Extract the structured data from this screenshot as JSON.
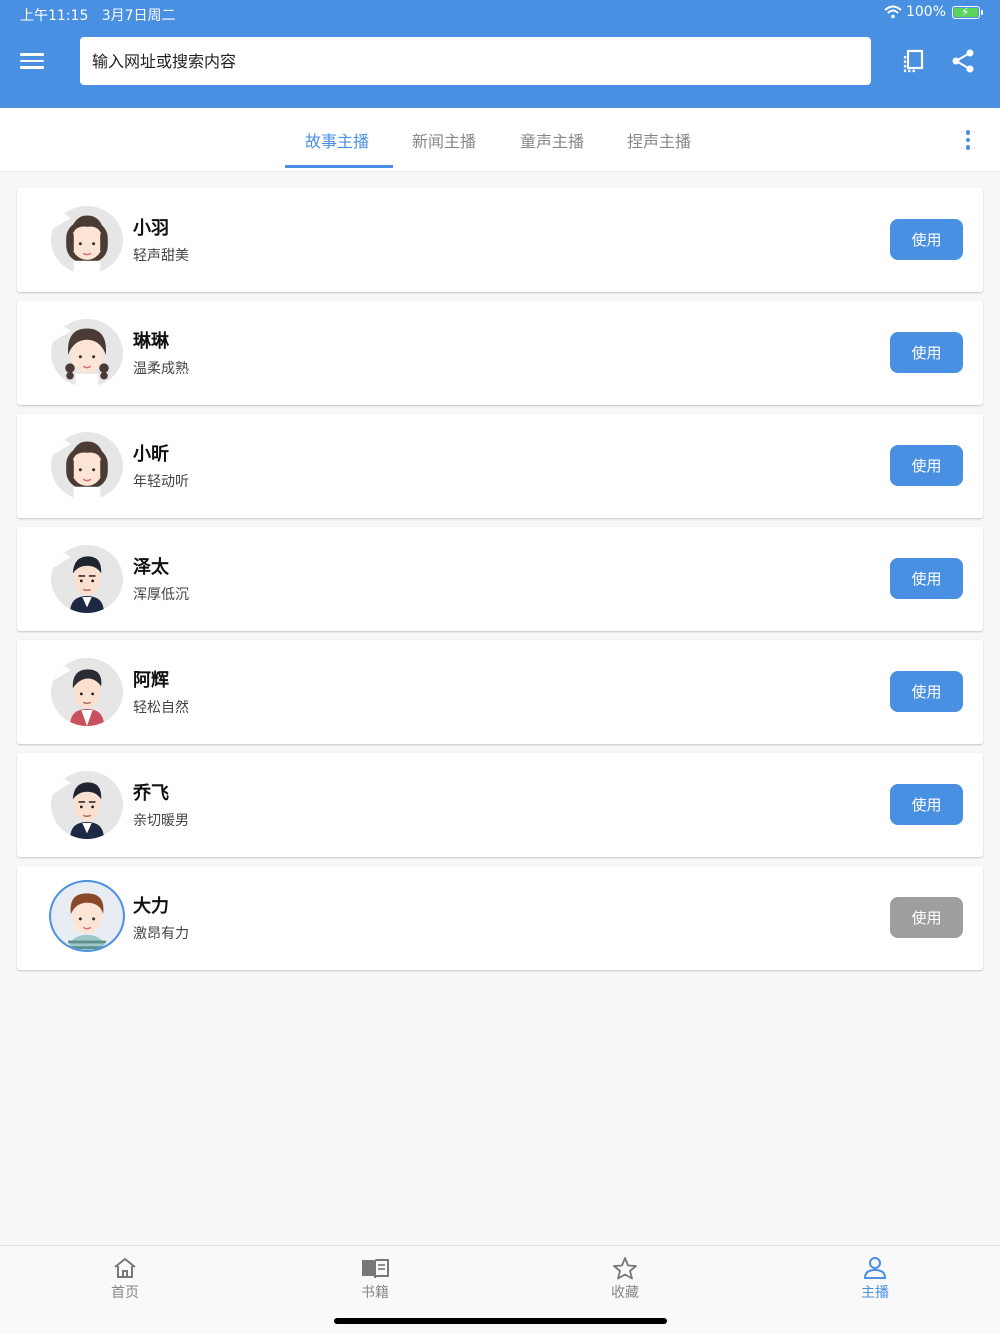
{
  "status_bar": {
    "time": "上午11:15",
    "date": "3月7日周二",
    "battery": "100%"
  },
  "header": {
    "search_placeholder": "输入网址或搜索内容",
    "accent_color": "#4a90e2"
  },
  "tabs": [
    {
      "label": "故事主播",
      "active": true
    },
    {
      "label": "新闻主播",
      "active": false
    },
    {
      "label": "童声主播",
      "active": false
    },
    {
      "label": "捏声主播",
      "active": false
    }
  ],
  "anchors": [
    {
      "name": "小羽",
      "desc": "轻声甜美",
      "button": "使用",
      "avatar": "girl-icon"
    },
    {
      "name": "琳琳",
      "desc": "温柔成熟",
      "button": "使用",
      "avatar": "girl-braids-icon"
    },
    {
      "name": "小昕",
      "desc": "年轻动听",
      "button": "使用",
      "avatar": "girl-icon"
    },
    {
      "name": "泽太",
      "desc": "浑厚低沉",
      "button": "使用",
      "avatar": "man-suit-icon"
    },
    {
      "name": "阿辉",
      "desc": "轻松自然",
      "button": "使用",
      "avatar": "man-casual-icon"
    },
    {
      "name": "乔飞",
      "desc": "亲切暖男",
      "button": "使用",
      "avatar": "man-suit-icon"
    },
    {
      "name": "大力",
      "desc": "激昂有力",
      "button": "使用",
      "avatar": "boy-icon",
      "selected": true
    }
  ],
  "bottom_nav": [
    {
      "label": "首页",
      "icon": "home-icon"
    },
    {
      "label": "书籍",
      "icon": "book-icon"
    },
    {
      "label": "收藏",
      "icon": "star-icon"
    },
    {
      "label": "主播",
      "icon": "person-icon",
      "active": true
    }
  ]
}
